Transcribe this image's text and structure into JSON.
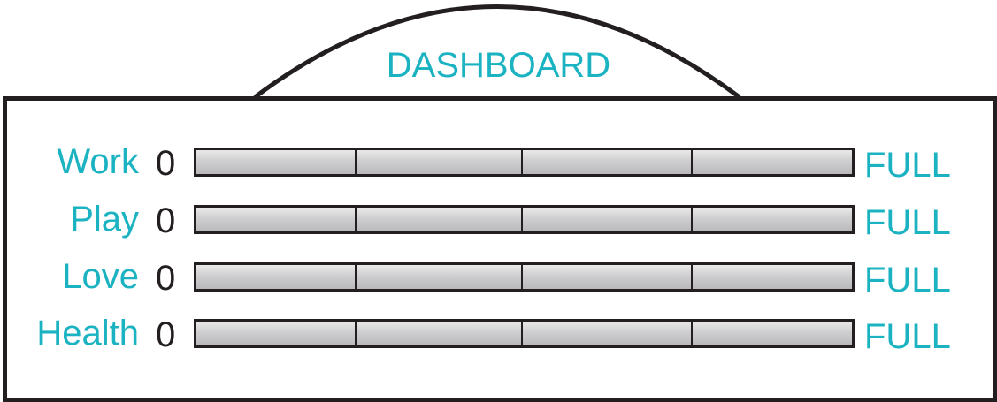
{
  "dashboard": {
    "title": "DASHBOARD",
    "min_label": "0",
    "max_label": "FULL",
    "colors": {
      "accent": "#1bb3c2",
      "outline": "#231f20",
      "gauge_fill": "#cfcfd1"
    },
    "rows": [
      {
        "label": "Work",
        "level": 0
      },
      {
        "label": "Play",
        "level": 0
      },
      {
        "label": "Love",
        "level": 0
      },
      {
        "label": "Health",
        "level": 0
      }
    ]
  }
}
